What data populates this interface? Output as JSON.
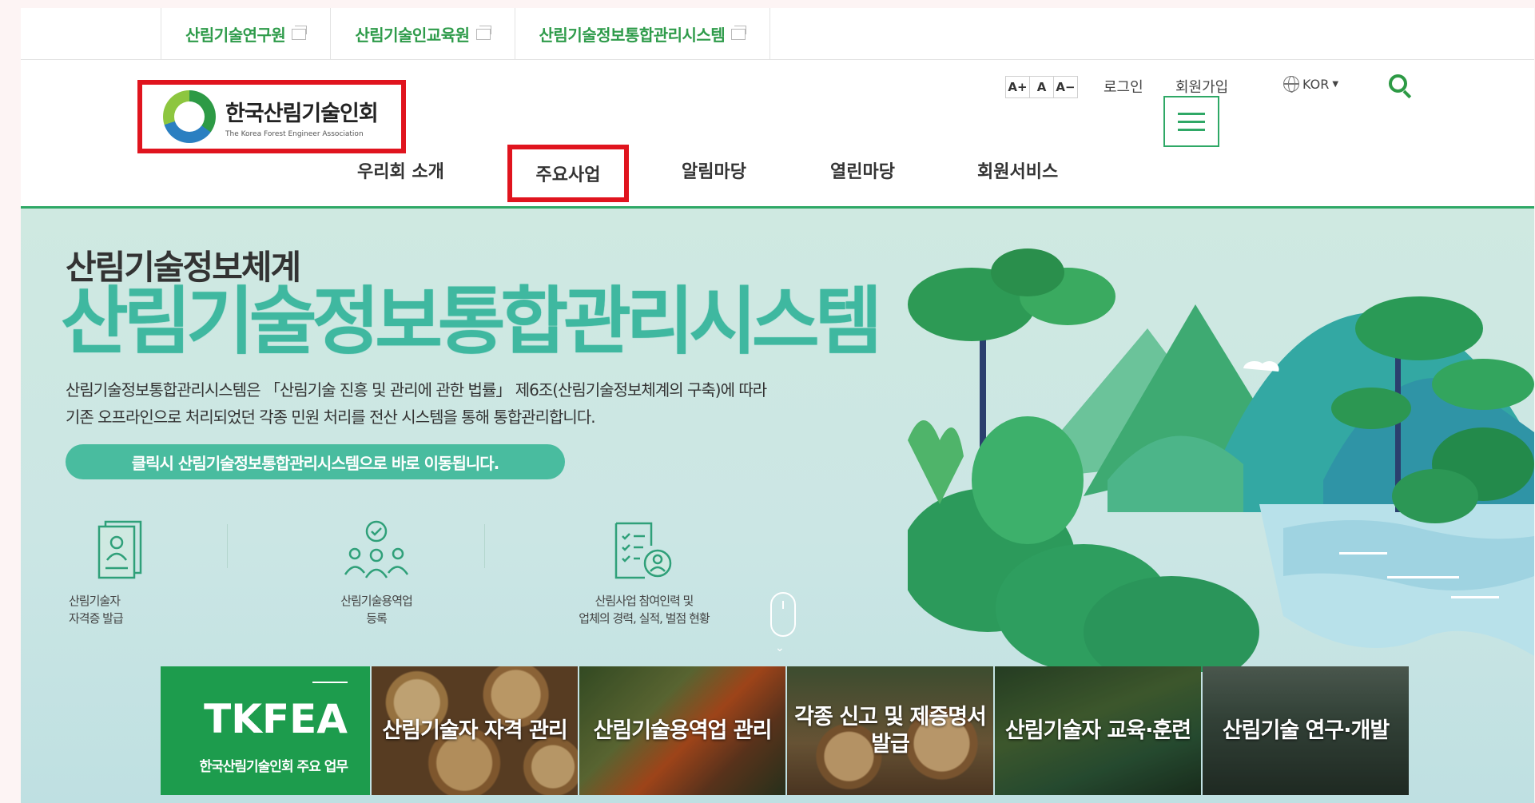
{
  "topbar": {
    "links": [
      {
        "label": "산림기술연구원"
      },
      {
        "label": "산림기술인교육원"
      },
      {
        "label": "산림기술정보통합관리시스템"
      }
    ]
  },
  "header": {
    "logo_title": "한국산림기술인회",
    "logo_subtitle": "The Korea Forest Engineer Association",
    "font_controls": [
      "A+",
      "A",
      "A−"
    ],
    "login": "로그인",
    "signup": "회원가입",
    "language": "KOR",
    "nav": [
      "우리회 소개",
      "주요사업",
      "알림마당",
      "열린마당",
      "회원서비스"
    ]
  },
  "hero": {
    "subtitle": "산림기술정보체계",
    "title": "산림기술정보통합관리시스템",
    "desc_line1": "산림기술정보통합관리시스템은 「산림기술 진흥 및 관리에 관한 법률」 제6조(산림기술정보체계의 구축)에 따라",
    "desc_line2": "기존 오프라인으로 처리되었던 각종 민원 처리를 전산 시스템을 통해 통합관리합니다.",
    "cta": "클릭시 산림기술정보통합관리시스템으로 바로 이동됩니다.",
    "quick_links": [
      {
        "line1": "산림기술자",
        "line2": "자격증 발급"
      },
      {
        "line1": "산림기술용역업",
        "line2": "등록"
      },
      {
        "line1": "산림사업 참여인력 및",
        "line2": "업체의 경력, 실적, 벌점 현황"
      }
    ]
  },
  "cards": {
    "feature_title": "TKFEA",
    "feature_desc": "한국산림기술인회 주요 업무",
    "items": [
      {
        "line1": "산림기술자 자격 관리",
        "line2": ""
      },
      {
        "line1": "산림기술용역업 관리",
        "line2": ""
      },
      {
        "line1": "각종 신고 및 제증명서",
        "line2": "발급"
      },
      {
        "line1": "산림기술자 교육·훈련",
        "line2": ""
      },
      {
        "line1": "산림기술 연구·개발",
        "line2": ""
      }
    ]
  },
  "colors": {
    "brand_green": "#2d9a45",
    "hero_title": "#3fb8a0",
    "highlight_red": "#e0141e"
  }
}
